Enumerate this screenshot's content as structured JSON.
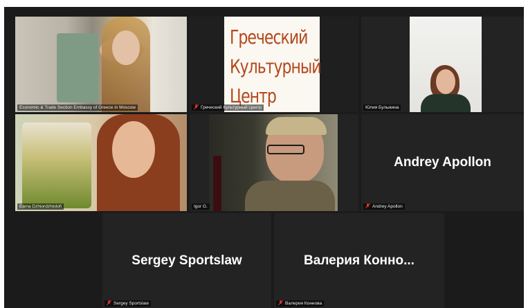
{
  "participants": [
    {
      "id": "embassy",
      "name": "Economic & Trade Section Embassy of Greece in Moscow",
      "muted": false,
      "video": true
    },
    {
      "id": "center",
      "name": "Греческий Культурный Центр",
      "muted": true,
      "video": true,
      "logo_lines": [
        "Греческий",
        "Культурный",
        "Центр"
      ]
    },
    {
      "id": "yulia",
      "name": "Юлия Булыкина",
      "muted": false,
      "video": true
    },
    {
      "id": "elena",
      "name": "Elena Dzhiordzhiolofi",
      "muted": false,
      "video": true,
      "active": true
    },
    {
      "id": "igor",
      "name": "Igor G.",
      "muted": false,
      "video": true
    },
    {
      "id": "andrey",
      "name": "Andrey Apollon",
      "muted": true,
      "video": false,
      "display_name": "Andrey Apollon"
    },
    {
      "id": "sergey",
      "name": "Sergey Sportslaw",
      "muted": true,
      "video": false,
      "display_name": "Sergey Sportslaw"
    },
    {
      "id": "valeria",
      "name": "Валерия Коннова",
      "muted": true,
      "video": false,
      "display_name": "Валерия Конно..."
    }
  ],
  "colors": {
    "active_border": "#d8e24a",
    "mute_red": "#e0322b",
    "tile_bg": "#232323",
    "stage_bg": "#1b1b1b"
  }
}
